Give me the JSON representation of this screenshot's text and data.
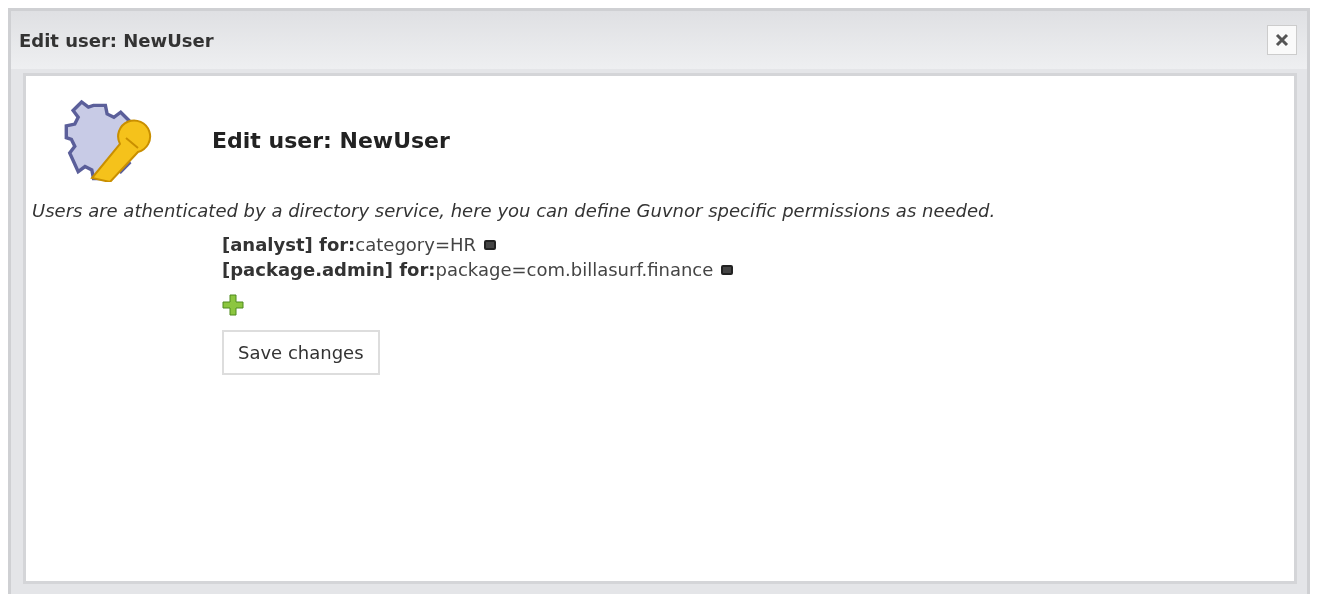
{
  "window": {
    "title": "Edit user: NewUser"
  },
  "heading": "Edit user: NewUser",
  "description": "Users are athenticated by a directory service, here you can define Guvnor specific permissions as needed.",
  "permissions": [
    {
      "role": "[analyst] for:",
      "scopes": [
        "category=HR"
      ]
    },
    {
      "role": "[package.admin] for:",
      "scopes": [
        "package=com.billasurf.finance"
      ]
    }
  ],
  "save_button": "Save changes"
}
